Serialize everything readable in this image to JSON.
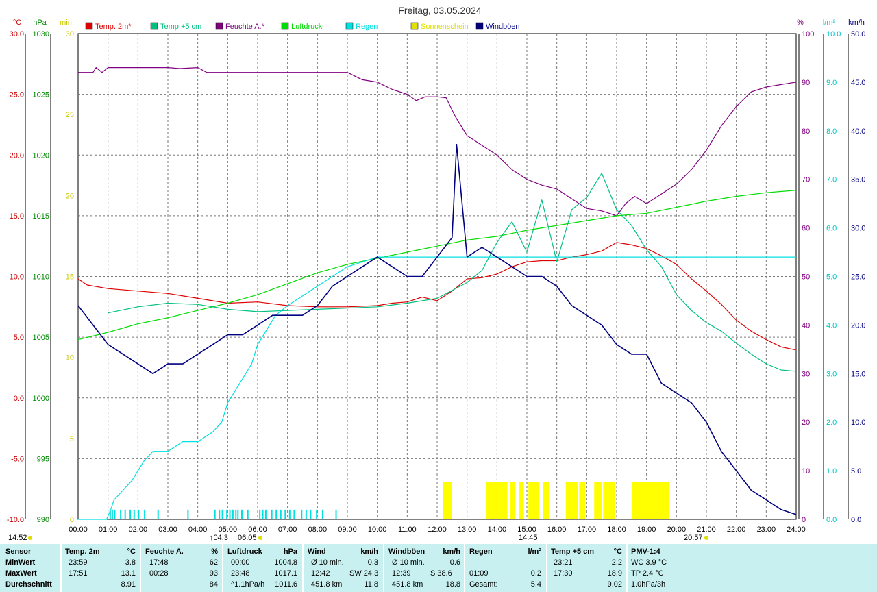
{
  "chart_data": {
    "type": "line",
    "title": "Freitag, 03.05.2024",
    "unit_labels": {
      "temp": "°C",
      "hpa": "hPa",
      "min": "min",
      "pct": "%",
      "rain": "l/m²",
      "kmh": "km/h"
    },
    "axes": {
      "temp": {
        "range": [
          -10,
          30
        ],
        "ticks": [
          "-10.0",
          "-5.0",
          "0.0",
          "5.0",
          "10.0",
          "15.0",
          "20.0",
          "25.0",
          "30.0"
        ],
        "color": "#cc0000"
      },
      "hpa": {
        "range": [
          990,
          1030
        ],
        "ticks": [
          "990",
          "995",
          "1000",
          "1005",
          "1010",
          "1015",
          "1020",
          "1025",
          "1030"
        ],
        "color": "#008800"
      },
      "min": {
        "range": [
          0,
          30
        ],
        "ticks": [
          "0",
          "5",
          "10",
          "15",
          "20",
          "25",
          "30"
        ],
        "color": "#c8c800"
      },
      "pct": {
        "range": [
          0,
          100
        ],
        "ticks": [
          "0",
          "10",
          "20",
          "30",
          "40",
          "50",
          "60",
          "70",
          "80",
          "90",
          "100"
        ],
        "color": "#800080"
      },
      "rain": {
        "range": [
          0,
          10
        ],
        "ticks": [
          "0.0",
          "1.0",
          "2.0",
          "3.0",
          "4.0",
          "5.0",
          "6.0",
          "7.0",
          "8.0",
          "9.0",
          "10.0"
        ],
        "color": "#00c8c8"
      },
      "kmh": {
        "range": [
          0,
          50
        ],
        "ticks": [
          "0.0",
          "5.0",
          "10.0",
          "15.0",
          "20.0",
          "25.0",
          "30.0",
          "35.0",
          "40.0",
          "45.0",
          "50.0"
        ],
        "color": "#000080"
      }
    },
    "x_ticks": [
      "00:00",
      "01:00",
      "02:00",
      "03:00",
      "04:00",
      "05:00",
      "06:00",
      "07:00",
      "08:00",
      "09:00",
      "10:00",
      "11:00",
      "12:00",
      "13:00",
      "14:00",
      "15:00",
      "16:00",
      "17:00",
      "18:00",
      "19:00",
      "20:00",
      "21:00",
      "22:00",
      "23:00",
      "24:00"
    ],
    "legend": [
      {
        "name": "Temp. 2m*",
        "color": "#dd0000"
      },
      {
        "name": "Temp +5 cm",
        "color": "#00c080"
      },
      {
        "name": "Feuchte A.*",
        "color": "#800080"
      },
      {
        "name": "Luftdruck",
        "color": "#00dd00"
      },
      {
        "name": "Regen",
        "color": "#00e0e0"
      },
      {
        "name": "Sonnenschein",
        "color": "#e0e000"
      },
      {
        "name": "Windböen",
        "color": "#000080"
      }
    ],
    "series": [
      {
        "name": "Temp. 2m*",
        "axis": "temp",
        "color": "#dd0000",
        "x": [
          0,
          0.3,
          1,
          2,
          3,
          4,
          5,
          6,
          7,
          8,
          9,
          10,
          10.5,
          11,
          11.5,
          12,
          12.5,
          13,
          13.5,
          14,
          14.5,
          15,
          15.5,
          16,
          16.5,
          17,
          17.5,
          18,
          18.5,
          19,
          19.5,
          20,
          20.5,
          21,
          21.5,
          22,
          22.5,
          23,
          23.5,
          23.98
        ],
        "y": [
          9.8,
          9.3,
          9.0,
          8.8,
          8.6,
          8.2,
          7.8,
          7.9,
          7.6,
          7.5,
          7.5,
          7.6,
          7.8,
          7.9,
          8.3,
          8.0,
          8.8,
          9.8,
          9.9,
          10.2,
          10.8,
          11.2,
          11.3,
          11.3,
          11.6,
          11.8,
          12.1,
          12.8,
          12.6,
          12.3,
          11.7,
          11.0,
          9.8,
          8.8,
          7.7,
          6.4,
          5.5,
          4.8,
          4.2,
          3.95
        ]
      },
      {
        "name": "Feuchte A.*",
        "axis": "pct",
        "color": "#800080",
        "x": [
          0,
          0.5,
          0.6,
          0.8,
          1,
          2,
          3,
          3.4,
          4,
          4.3,
          5,
          6,
          7,
          8,
          9,
          9.5,
          10,
          10.5,
          11,
          11.3,
          11.6,
          12,
          12.3,
          12.6,
          13,
          13.5,
          14,
          14.5,
          15,
          15.5,
          16,
          16.5,
          17,
          17.5,
          18,
          18.3,
          18.6,
          19,
          19.5,
          20,
          20.5,
          21,
          21.5,
          22,
          22.5,
          23,
          23.5,
          24
        ],
        "y": [
          92,
          92,
          93,
          92,
          93,
          93,
          93,
          92.8,
          93,
          92,
          92,
          92,
          92,
          92,
          92,
          90.5,
          90,
          88.5,
          87.5,
          86.2,
          87,
          87,
          86.8,
          83,
          79,
          77,
          75,
          72,
          70,
          68.8,
          68,
          66,
          64,
          63.5,
          62.5,
          65,
          66.5,
          65,
          67,
          69,
          72,
          76,
          81,
          85,
          88,
          89,
          89.5,
          90
        ]
      },
      {
        "name": "Luftdruck",
        "axis": "hpa",
        "color": "#00dd00",
        "x": [
          0,
          1,
          2,
          3,
          4,
          5,
          6,
          7,
          8,
          9,
          10,
          11,
          12,
          13,
          14,
          15,
          16,
          17,
          18,
          19,
          20,
          21,
          22,
          23,
          24
        ],
        "y": [
          1004.8,
          1005.4,
          1006.1,
          1006.6,
          1007.2,
          1007.8,
          1008.5,
          1009.4,
          1010.3,
          1011.0,
          1011.5,
          1012.0,
          1012.5,
          1013.0,
          1013.3,
          1013.8,
          1014.2,
          1014.6,
          1015.0,
          1015.2,
          1015.7,
          1016.2,
          1016.6,
          1016.9,
          1017.1
        ]
      },
      {
        "name": "Temp +5 cm",
        "axis": "temp",
        "color": "#00c080",
        "x": [
          1,
          2,
          3,
          4,
          5,
          6,
          7,
          8,
          9,
          10,
          11,
          12,
          13,
          13.5,
          14,
          14.5,
          15,
          15.5,
          16,
          16.5,
          17,
          17.5,
          18,
          18.5,
          19,
          19.5,
          20,
          20.5,
          21,
          21.5,
          22,
          22.5,
          23,
          23.5,
          23.98
        ],
        "y": [
          7.0,
          7.5,
          7.8,
          7.7,
          7.3,
          7.1,
          7.2,
          7.3,
          7.4,
          7.5,
          7.8,
          8.2,
          9.5,
          10.5,
          12.8,
          14.5,
          12.0,
          16.3,
          11.2,
          15.5,
          16.5,
          18.5,
          15.5,
          14.2,
          12.2,
          10.8,
          8.5,
          7.2,
          6.2,
          5.5,
          4.5,
          3.6,
          2.8,
          2.3,
          2.2
        ]
      },
      {
        "name": "Regen",
        "axis": "rain",
        "color": "#00e0e0",
        "x": [
          0,
          0.95,
          1.09,
          1.2,
          1.5,
          1.8,
          2.0,
          2.2,
          2.5,
          3.0,
          3.5,
          4.0,
          4.5,
          4.8,
          5.0,
          5.2,
          5.5,
          5.8,
          6.0,
          6.3,
          6.6,
          7.0,
          7.5,
          8.0,
          9.0,
          10.0,
          12.0,
          16.0,
          20.0,
          24.0
        ],
        "y": [
          0.0,
          0.0,
          0.2,
          0.4,
          0.6,
          0.8,
          1.0,
          1.2,
          1.4,
          1.4,
          1.6,
          1.6,
          1.8,
          2.0,
          2.4,
          2.6,
          2.9,
          3.2,
          3.6,
          3.9,
          4.2,
          4.4,
          4.6,
          4.8,
          5.2,
          5.4,
          5.4,
          5.4,
          5.4,
          5.4
        ]
      },
      {
        "name": "Windböen",
        "axis": "kmh",
        "color": "#000080",
        "x": [
          0,
          0.5,
          1,
          1.5,
          2,
          2.5,
          3,
          3.5,
          4,
          4.5,
          5,
          5.5,
          6,
          6.5,
          7,
          7.5,
          8,
          8.5,
          9,
          9.5,
          10,
          10.5,
          11,
          11.5,
          12,
          12.5,
          12.65,
          13,
          13.5,
          14,
          14.5,
          15,
          15.5,
          16,
          16.5,
          17,
          17.5,
          18,
          18.5,
          19,
          19.5,
          20,
          20.5,
          21,
          21.5,
          22,
          22.5,
          23,
          23.5,
          24
        ],
        "y": [
          22,
          20,
          18,
          17,
          16,
          15,
          16,
          16,
          17,
          18,
          19,
          19,
          20,
          21,
          21,
          21,
          22,
          24,
          25,
          26,
          27,
          26,
          25,
          25,
          27,
          29,
          38.6,
          27,
          28,
          27,
          26,
          25,
          25,
          24,
          22,
          21,
          20,
          18,
          17,
          17,
          14,
          13,
          12,
          10,
          7,
          5,
          3,
          2,
          1,
          0.5
        ]
      }
    ],
    "sunshine": {
      "name": "Sonnenschein",
      "color": "#ffff00",
      "height_min": 2.3,
      "intervals": [
        [
          12.2,
          12.5
        ],
        [
          13.65,
          14.35
        ],
        [
          14.45,
          14.6
        ],
        [
          14.75,
          14.9
        ],
        [
          15.05,
          15.4
        ],
        [
          15.55,
          15.75
        ],
        [
          16.3,
          16.7
        ],
        [
          16.75,
          16.95
        ],
        [
          17.25,
          17.5
        ],
        [
          17.55,
          17.95
        ],
        [
          18.5,
          19.75
        ]
      ]
    },
    "rain_bars": {
      "color": "#00e0e0",
      "height": 0.2,
      "x": [
        1.05,
        1.12,
        1.2,
        1.4,
        1.55,
        1.72,
        1.85,
        2.0,
        2.2,
        2.65,
        3.65,
        4.55,
        4.7,
        4.8,
        4.95,
        5.05,
        5.15,
        5.25,
        5.32,
        5.45,
        5.65,
        6.05,
        6.15,
        6.25,
        6.45,
        6.6,
        6.75,
        6.9,
        7.05,
        7.2,
        7.45,
        7.6,
        7.75,
        7.95,
        8.15,
        8.6
      ]
    },
    "bottom_markers": {
      "left_time": "14:52",
      "sunrise": "↑04:3",
      "sunrise2": "06:05",
      "max_marker": "14:45",
      "sunset": "20:57"
    }
  },
  "table": {
    "headers": {
      "sensor": "Sensor",
      "temp": "Temp. 2m",
      "temp_unit": "°C",
      "hum": "Feuchte A.",
      "hum_unit": "%",
      "press": "Luftdruck",
      "press_unit": "hPa",
      "wind": "Wind",
      "wind_unit": "km/h",
      "gust": "Windböen",
      "gust_unit": "km/h",
      "rain": "Regen",
      "rain_unit": "l/m²",
      "t5": "Temp +5 cm",
      "t5_unit": "°C",
      "pmv": "PMV-1:4"
    },
    "rows": [
      {
        "label": "MinWert",
        "temp_t": "23:59",
        "temp_v": "3.8",
        "hum_t": "17:48",
        "hum_v": "62",
        "press_t": "00:00",
        "press_v": "1004.8",
        "wind_t": "Ø 10 min.",
        "wind_v": "0.3",
        "gust_t": "Ø 10 min.",
        "gust_v": "0.6",
        "rain_t": "",
        "rain_v": "",
        "t5_t": "23:21",
        "t5_v": "2.2",
        "pmv": "WC 3.9 °C"
      },
      {
        "label": "MaxWert",
        "temp_t": "17:51",
        "temp_v": "13.1",
        "hum_t": "00:28",
        "hum_v": "93",
        "press_t": "23:48",
        "press_v": "1017.1",
        "wind_t": "12:42",
        "wind_m": "SW 24.3",
        "wind_v": "",
        "gust_t": "12:39",
        "gust_m": "S 38.6",
        "gust_v": "",
        "rain_t": "01:09",
        "rain_v": "0.2",
        "t5_t": "17:30",
        "t5_v": "18.9",
        "pmv": "TP 2.4 °C"
      },
      {
        "label": "Durchschnitt",
        "temp_t": "",
        "temp_v": "8.91",
        "hum_t": "",
        "hum_v": "84",
        "press_t": "^1.1hPa/h",
        "press_v": "1011.6",
        "wind_t": "451.8 km",
        "wind_v": "11.8",
        "gust_t": "451.8 km",
        "gust_v": "18.8",
        "rain_t": "Gesamt:",
        "rain_v": "5.4",
        "t5_t": "",
        "t5_v": "9.02",
        "pmv": "1.0hPa/3h"
      }
    ]
  }
}
